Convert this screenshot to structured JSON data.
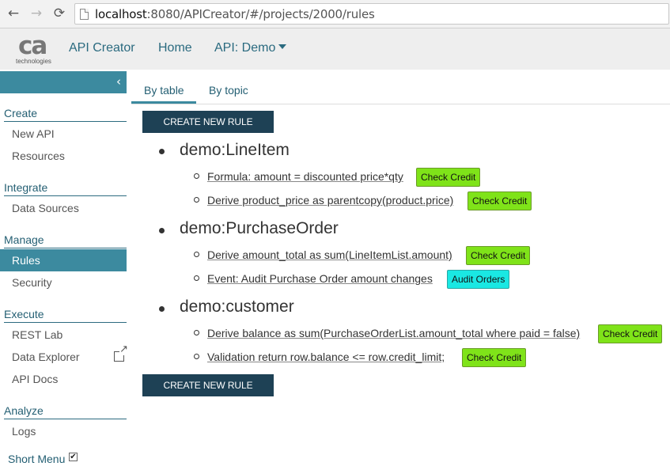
{
  "browser": {
    "back_glyph": "←",
    "forward_glyph": "→",
    "reload_glyph": "⟳",
    "url_host": "localhost",
    "url_rest": ":8080/APICreator/#/projects/2000/rules"
  },
  "header": {
    "logo_text": "ca",
    "logo_sub": "technologies",
    "app_name": "API Creator",
    "home": "Home",
    "api_menu": "API: Demo"
  },
  "sidebar": {
    "collapse_glyph": "‹",
    "sections": [
      {
        "title": "Create",
        "items": [
          "New API",
          "Resources"
        ]
      },
      {
        "title": "Integrate",
        "items": [
          "Data Sources"
        ]
      },
      {
        "title": "Manage",
        "items": [
          "Rules",
          "Security"
        ]
      },
      {
        "title": "Execute",
        "items": [
          "REST Lab",
          "Data Explorer",
          "API Docs"
        ]
      },
      {
        "title": "Analyze",
        "items": [
          "Logs"
        ]
      }
    ],
    "active_item": "Rules",
    "short_menu": "Short Menu",
    "short_menu_checked": true,
    "check_glyph": "✔"
  },
  "tabs": {
    "by_table": "By table",
    "by_topic": "By topic",
    "active": "By table"
  },
  "create_rule_label": "CREATE NEW RULE",
  "tables": [
    {
      "name": "demo:LineItem",
      "rules": [
        {
          "text": "Formula: amount = discounted price*qty",
          "badge": "Check Credit",
          "badge_color": "#7fe319"
        },
        {
          "text": "Derive product_price as parentcopy(product.price)",
          "badge": "Check Credit",
          "badge_color": "#7fe319"
        }
      ]
    },
    {
      "name": "demo:PurchaseOrder",
      "rules": [
        {
          "text": "Derive amount_total as sum(LineItemList.amount)",
          "badge": "Check Credit",
          "badge_color": "#7fe319"
        },
        {
          "text": "Event: Audit Purchase Order amount changes",
          "badge": "Audit Orders",
          "badge_color": "#1ae8e3"
        }
      ]
    },
    {
      "name": "demo:customer",
      "rules": [
        {
          "text": "Derive balance as sum(PurchaseOrderList.amount_total where paid = false)",
          "badge": "Check Credit",
          "badge_color": "#7fe319"
        },
        {
          "text": "Validation return row.balance <= row.credit_limit;",
          "badge": "Check Credit",
          "badge_color": "#7fe319"
        }
      ]
    }
  ],
  "colors": {
    "accent": "#3c8a9f",
    "button_dark": "#1e4155",
    "badge_green": "#7fe319",
    "badge_cyan": "#1ae8e3"
  }
}
